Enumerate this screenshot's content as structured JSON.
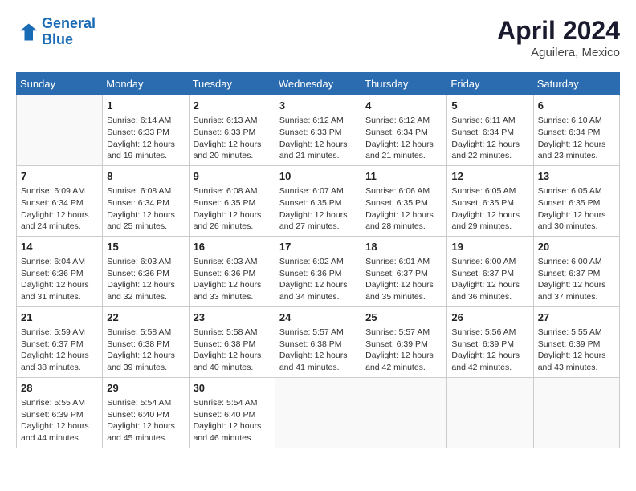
{
  "logo": {
    "line1": "General",
    "line2": "Blue"
  },
  "title": "April 2024",
  "subtitle": "Aguilera, Mexico",
  "headers": [
    "Sunday",
    "Monday",
    "Tuesday",
    "Wednesday",
    "Thursday",
    "Friday",
    "Saturday"
  ],
  "weeks": [
    [
      {
        "day": "",
        "info": ""
      },
      {
        "day": "1",
        "info": "Sunrise: 6:14 AM\nSunset: 6:33 PM\nDaylight: 12 hours\nand 19 minutes."
      },
      {
        "day": "2",
        "info": "Sunrise: 6:13 AM\nSunset: 6:33 PM\nDaylight: 12 hours\nand 20 minutes."
      },
      {
        "day": "3",
        "info": "Sunrise: 6:12 AM\nSunset: 6:33 PM\nDaylight: 12 hours\nand 21 minutes."
      },
      {
        "day": "4",
        "info": "Sunrise: 6:12 AM\nSunset: 6:34 PM\nDaylight: 12 hours\nand 21 minutes."
      },
      {
        "day": "5",
        "info": "Sunrise: 6:11 AM\nSunset: 6:34 PM\nDaylight: 12 hours\nand 22 minutes."
      },
      {
        "day": "6",
        "info": "Sunrise: 6:10 AM\nSunset: 6:34 PM\nDaylight: 12 hours\nand 23 minutes."
      }
    ],
    [
      {
        "day": "7",
        "info": "Sunrise: 6:09 AM\nSunset: 6:34 PM\nDaylight: 12 hours\nand 24 minutes."
      },
      {
        "day": "8",
        "info": "Sunrise: 6:08 AM\nSunset: 6:34 PM\nDaylight: 12 hours\nand 25 minutes."
      },
      {
        "day": "9",
        "info": "Sunrise: 6:08 AM\nSunset: 6:35 PM\nDaylight: 12 hours\nand 26 minutes."
      },
      {
        "day": "10",
        "info": "Sunrise: 6:07 AM\nSunset: 6:35 PM\nDaylight: 12 hours\nand 27 minutes."
      },
      {
        "day": "11",
        "info": "Sunrise: 6:06 AM\nSunset: 6:35 PM\nDaylight: 12 hours\nand 28 minutes."
      },
      {
        "day": "12",
        "info": "Sunrise: 6:05 AM\nSunset: 6:35 PM\nDaylight: 12 hours\nand 29 minutes."
      },
      {
        "day": "13",
        "info": "Sunrise: 6:05 AM\nSunset: 6:35 PM\nDaylight: 12 hours\nand 30 minutes."
      }
    ],
    [
      {
        "day": "14",
        "info": "Sunrise: 6:04 AM\nSunset: 6:36 PM\nDaylight: 12 hours\nand 31 minutes."
      },
      {
        "day": "15",
        "info": "Sunrise: 6:03 AM\nSunset: 6:36 PM\nDaylight: 12 hours\nand 32 minutes."
      },
      {
        "day": "16",
        "info": "Sunrise: 6:03 AM\nSunset: 6:36 PM\nDaylight: 12 hours\nand 33 minutes."
      },
      {
        "day": "17",
        "info": "Sunrise: 6:02 AM\nSunset: 6:36 PM\nDaylight: 12 hours\nand 34 minutes."
      },
      {
        "day": "18",
        "info": "Sunrise: 6:01 AM\nSunset: 6:37 PM\nDaylight: 12 hours\nand 35 minutes."
      },
      {
        "day": "19",
        "info": "Sunrise: 6:00 AM\nSunset: 6:37 PM\nDaylight: 12 hours\nand 36 minutes."
      },
      {
        "day": "20",
        "info": "Sunrise: 6:00 AM\nSunset: 6:37 PM\nDaylight: 12 hours\nand 37 minutes."
      }
    ],
    [
      {
        "day": "21",
        "info": "Sunrise: 5:59 AM\nSunset: 6:37 PM\nDaylight: 12 hours\nand 38 minutes."
      },
      {
        "day": "22",
        "info": "Sunrise: 5:58 AM\nSunset: 6:38 PM\nDaylight: 12 hours\nand 39 minutes."
      },
      {
        "day": "23",
        "info": "Sunrise: 5:58 AM\nSunset: 6:38 PM\nDaylight: 12 hours\nand 40 minutes."
      },
      {
        "day": "24",
        "info": "Sunrise: 5:57 AM\nSunset: 6:38 PM\nDaylight: 12 hours\nand 41 minutes."
      },
      {
        "day": "25",
        "info": "Sunrise: 5:57 AM\nSunset: 6:39 PM\nDaylight: 12 hours\nand 42 minutes."
      },
      {
        "day": "26",
        "info": "Sunrise: 5:56 AM\nSunset: 6:39 PM\nDaylight: 12 hours\nand 42 minutes."
      },
      {
        "day": "27",
        "info": "Sunrise: 5:55 AM\nSunset: 6:39 PM\nDaylight: 12 hours\nand 43 minutes."
      }
    ],
    [
      {
        "day": "28",
        "info": "Sunrise: 5:55 AM\nSunset: 6:39 PM\nDaylight: 12 hours\nand 44 minutes."
      },
      {
        "day": "29",
        "info": "Sunrise: 5:54 AM\nSunset: 6:40 PM\nDaylight: 12 hours\nand 45 minutes."
      },
      {
        "day": "30",
        "info": "Sunrise: 5:54 AM\nSunset: 6:40 PM\nDaylight: 12 hours\nand 46 minutes."
      },
      {
        "day": "",
        "info": ""
      },
      {
        "day": "",
        "info": ""
      },
      {
        "day": "",
        "info": ""
      },
      {
        "day": "",
        "info": ""
      }
    ]
  ]
}
